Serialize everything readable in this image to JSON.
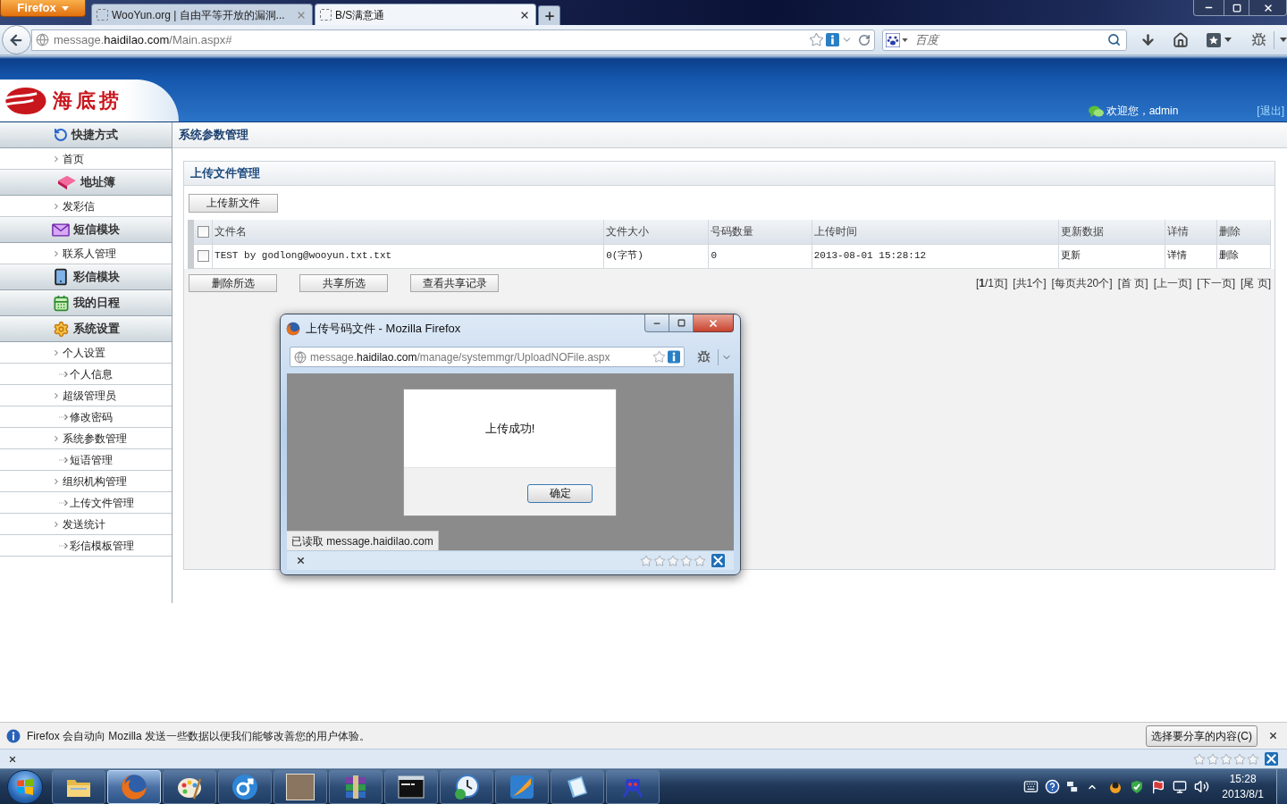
{
  "browser": {
    "menu_button": "Firefox",
    "tabs": [
      {
        "title": "WooYun.org | 自由平等开放的漏洞...",
        "selected": false
      },
      {
        "title": "B/S满意通",
        "selected": true
      }
    ],
    "address": {
      "subdomain": "message.",
      "domain": "haidilao.com",
      "path": "/Main.aspx#"
    },
    "search": {
      "placeholder": "百度"
    }
  },
  "header": {
    "logo": "海底捞",
    "welcome": "欢迎您，admin",
    "logout": "[退出]"
  },
  "sidebar": {
    "sections": [
      {
        "title": "快捷方式",
        "items": [
          {
            "label": "首页"
          }
        ]
      },
      {
        "title": "地址簿",
        "items": [
          {
            "label": "发彩信"
          }
        ]
      },
      {
        "title": "短信模块",
        "items": [
          {
            "label": "联系人管理"
          }
        ]
      },
      {
        "title": "彩信模块"
      },
      {
        "title": "我的日程"
      },
      {
        "title": "系统设置",
        "items": [
          {
            "label": "个人设置",
            "children": [
              {
                "label": "个人信息"
              }
            ]
          },
          {
            "label": "超级管理员",
            "children": [
              {
                "label": "修改密码"
              }
            ]
          },
          {
            "label": "系统参数管理",
            "children": [
              {
                "label": "短语管理"
              }
            ]
          },
          {
            "label": "组织机构管理",
            "children": [
              {
                "label": "上传文件管理"
              }
            ]
          },
          {
            "label": "发送统计",
            "children": [
              {
                "label": "彩信模板管理"
              }
            ]
          }
        ]
      }
    ]
  },
  "content": {
    "title": "系统参数管理",
    "panel": {
      "title": "上传文件管理",
      "upload_button": "上传新文件",
      "table": {
        "all_checked": false,
        "columns": [
          "文件名",
          "文件大小",
          "号码数量",
          "上传时间",
          "更新数据",
          "详情",
          "删除"
        ],
        "rows": [
          {
            "checked": false,
            "cells": [
              "TEST by godlong@wooyun.txt.txt",
              "0(字节)",
              "0",
              "2013-08-01 15:28:12",
              "更新",
              "详情",
              "删除"
            ]
          }
        ]
      },
      "actions": [
        "删除所选",
        "共享所选",
        "查看共享记录"
      ],
      "pagination": [
        "[**1**/1页]",
        "[共1个]",
        "[每页共20个]",
        "[首 页]",
        "[上一页]",
        "[下一页]",
        "[尾 页]"
      ]
    }
  },
  "dialog": {
    "title": "上传号码文件 - Mozilla Firefox",
    "address": {
      "subdomain": "message.",
      "domain": "haidilao.com",
      "path": "/manage/systemmgr/UploadNOFile.aspx"
    },
    "alert": {
      "message": "上传成功!",
      "button": "确定"
    },
    "status": "已读取 message.haidilao.com",
    "stars": 0
  },
  "notification": {
    "text": "Firefox 会自动向 Mozilla 发送一些数据以便我们能够改善您的用户体验。",
    "button": "选择要分享的内容(C)"
  },
  "addon_bar": {
    "stars": 0
  },
  "taskbar": {
    "apps": [
      {
        "selected": false
      },
      {
        "selected": true
      },
      {
        "selected": false
      },
      {
        "selected": false
      },
      {
        "selected": false
      },
      {
        "selected": false
      },
      {
        "selected": false
      },
      {
        "selected": false
      },
      {
        "selected": false
      },
      {
        "selected": false
      },
      {
        "selected": false
      }
    ],
    "clock": {
      "time": "15:28",
      "date": "2013/8/1"
    }
  }
}
